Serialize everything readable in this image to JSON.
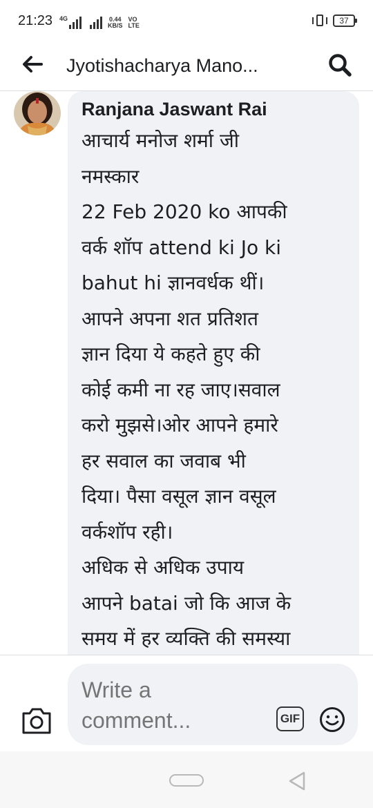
{
  "status_bar": {
    "time": "21:23",
    "network_type": "4G",
    "speed_value": "0.44",
    "speed_unit": "KB/S",
    "volte_top": "VO",
    "volte_bottom": "LTE",
    "battery": "37"
  },
  "header": {
    "title": "Jyotishacharya Mano..."
  },
  "comment": {
    "author": "Ranjana Jaswant Rai",
    "lines": [
      "आचार्य मनोज शर्मा जी",
      "नमस्कार",
      "22 Feb 2020 ko आपकी",
      "वर्क शॉप attend ki Jo ki",
      "bahut hi ज्ञानवर्धक थीं।",
      "आपने अपना शत प्रतिशत",
      "ज्ञान दिया ये कहते हुए की",
      "कोई कमी ना रह जाए।सवाल",
      "करो मुझसे।ओर आपने हमारे",
      "हर सवाल का जवाब भी",
      "दिया। पैसा वसूल ज्ञान वसूल",
      "वर्कशॉप रही।",
      "अधिक से अधिक उपाय",
      "आपने batai जो कि आज के",
      "समय में हर व्यक्ति की समस्या"
    ]
  },
  "composer": {
    "placeholder": "Write a comment...",
    "gif_label": "GIF"
  },
  "icons": {
    "back": "arrow-left-icon",
    "search": "search-icon",
    "camera": "camera-icon",
    "emoji": "smiley-icon"
  }
}
